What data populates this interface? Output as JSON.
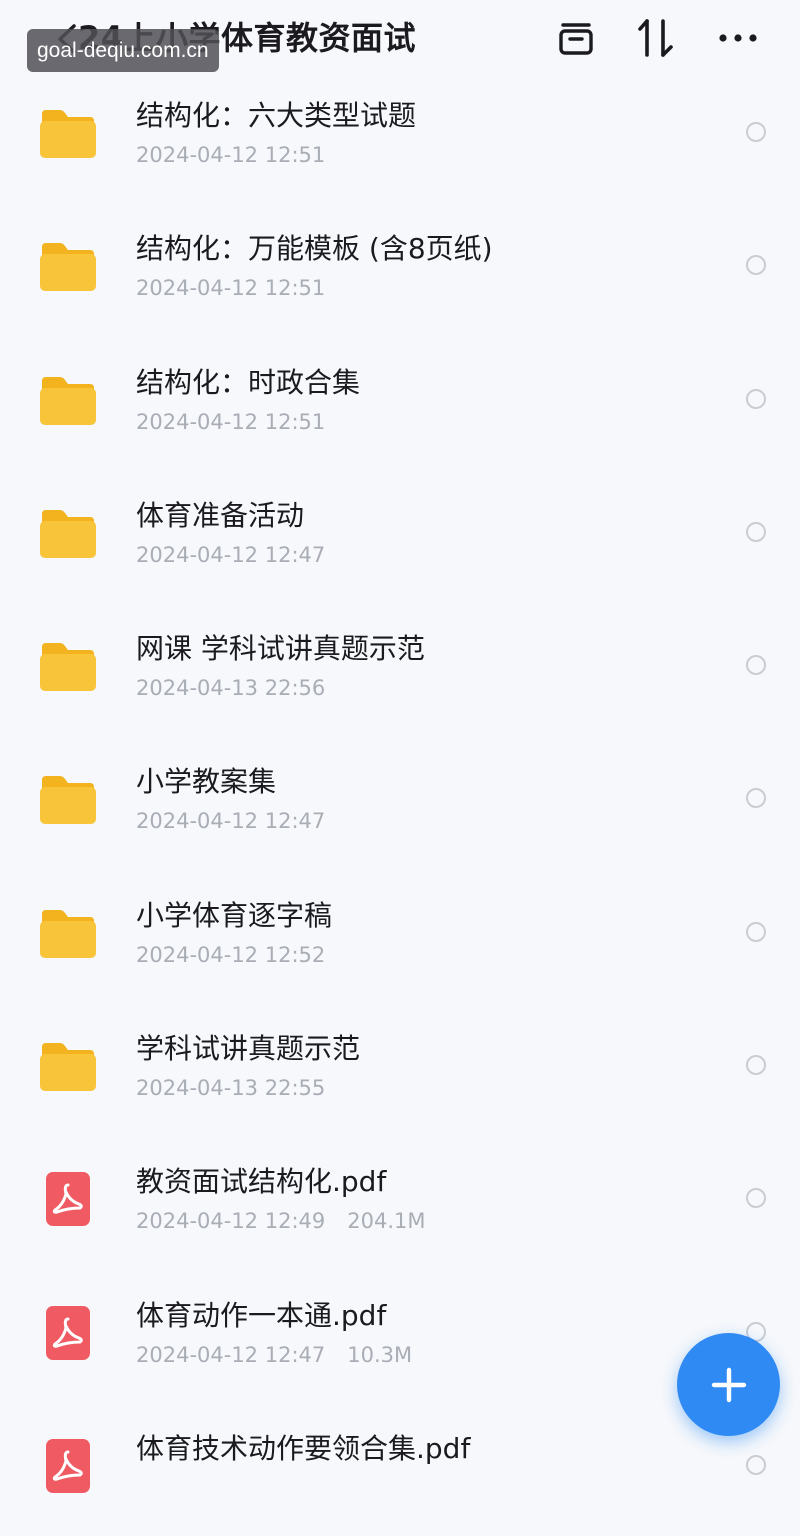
{
  "header": {
    "title": "24上小学体育教资面试"
  },
  "watermark": "goal-deqiu.com.cn",
  "files": [
    {
      "name": "结构化：六大类型试题",
      "date": "2024-04-12 12:51",
      "size": "",
      "type": "folder"
    },
    {
      "name": "结构化：万能模板 (含8页纸)",
      "date": "2024-04-12 12:51",
      "size": "",
      "type": "folder"
    },
    {
      "name": "结构化：时政合集",
      "date": "2024-04-12 12:51",
      "size": "",
      "type": "folder"
    },
    {
      "name": "体育准备活动",
      "date": "2024-04-12 12:47",
      "size": "",
      "type": "folder"
    },
    {
      "name": "网课 学科试讲真题示范",
      "date": "2024-04-13 22:56",
      "size": "",
      "type": "folder"
    },
    {
      "name": "小学教案集",
      "date": "2024-04-12 12:47",
      "size": "",
      "type": "folder"
    },
    {
      "name": "小学体育逐字稿",
      "date": "2024-04-12 12:52",
      "size": "",
      "type": "folder"
    },
    {
      "name": "学科试讲真题示范",
      "date": "2024-04-13 22:55",
      "size": "",
      "type": "folder"
    },
    {
      "name": "教资面试结构化.pdf",
      "date": "2024-04-12 12:49",
      "size": "204.1M",
      "type": "pdf"
    },
    {
      "name": "体育动作一本通.pdf",
      "date": "2024-04-12 12:47",
      "size": "10.3M",
      "type": "pdf"
    },
    {
      "name": "体育技术动作要领合集.pdf",
      "date": "",
      "size": "",
      "type": "pdf"
    }
  ],
  "colors": {
    "accent": "#2f8bf3",
    "folder": "#f8c53a",
    "pdf": "#ef5a63",
    "meta_text": "#a9adb5",
    "background": "#f6f8fb"
  },
  "icons": {
    "back": "chevron-left-icon",
    "archive": "archive-box-icon",
    "sort": "sort-arrows-icon",
    "more": "more-dots-icon",
    "folder": "folder-icon",
    "pdf": "pdf-file-icon",
    "add": "plus-icon"
  }
}
